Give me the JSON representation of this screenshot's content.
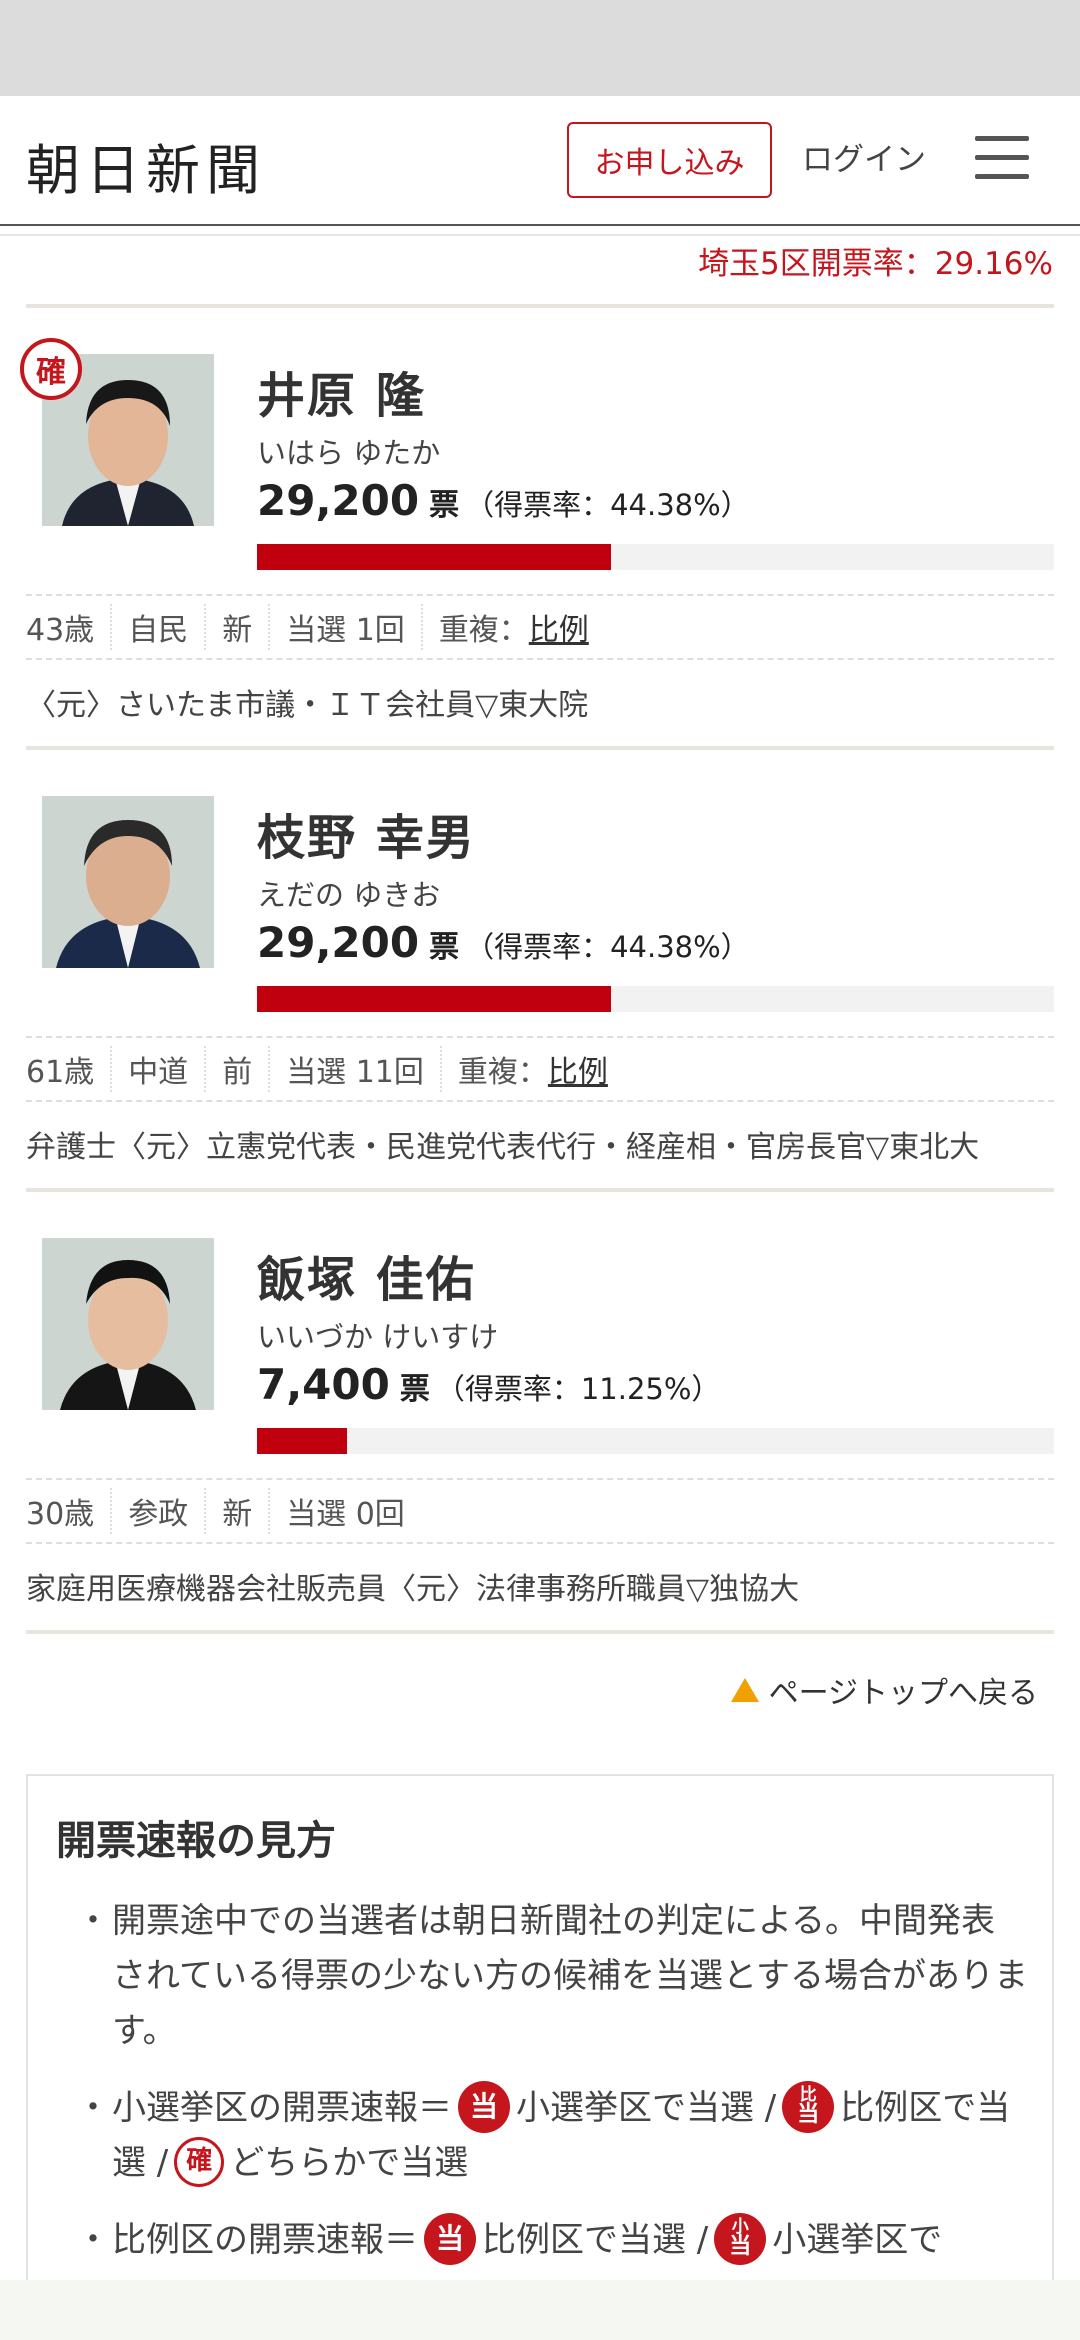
{
  "header": {
    "logo": "朝日新聞",
    "subscribe_label": "お申し込み",
    "login_label": "ログイン",
    "menu_icon": "hamburger-menu-icon"
  },
  "district_rate": "埼玉5区開票率：29.16%",
  "candidates": [
    {
      "elected_badge": "確",
      "name": "井原 隆",
      "kana": "いはら ゆたか",
      "votes": "29,200",
      "vote_unit": "票",
      "vote_share_text": "（得票率：44.38%）",
      "vote_share": 44.38,
      "meta": [
        "43歳",
        "自民",
        "新",
        "当選 1回"
      ],
      "duplicate_label": "重複：",
      "duplicate_link": "比例",
      "career": "〈元〉さいたま市議・ＩＴ会社員▽東大院"
    },
    {
      "elected_badge": "",
      "name": "枝野 幸男",
      "kana": "えだの ゆきお",
      "votes": "29,200",
      "vote_unit": "票",
      "vote_share_text": "（得票率：44.38%）",
      "vote_share": 44.38,
      "meta": [
        "61歳",
        "中道",
        "前",
        "当選 11回"
      ],
      "duplicate_label": "重複：",
      "duplicate_link": "比例",
      "career": "弁護士〈元〉立憲党代表・民進党代表代行・経産相・官房長官▽東北大"
    },
    {
      "elected_badge": "",
      "name": "飯塚 佳佑",
      "kana": "いいづか けいすけ",
      "votes": "7,400",
      "vote_unit": "票",
      "vote_share_text": "（得票率：11.25%）",
      "vote_share": 11.25,
      "meta": [
        "30歳",
        "参政",
        "新",
        "当選 0回"
      ],
      "duplicate_label": "",
      "duplicate_link": "",
      "career": "家庭用医療機器会社販売員〈元〉法律事務所職員▽独協大"
    }
  ],
  "page_top_label": "ページトップへ戻る",
  "guide": {
    "title": "開票速報の見方",
    "bullet": "・",
    "item1": "開票途中での当選者は朝日新聞社の判定による。中間発表されている得票の少ない方の候補を当選とする場合があります。",
    "item2_a": "小選挙区の開票速報＝",
    "item2_b": "小選挙区で当選 /",
    "item2_c": "比例区で当選 /",
    "item2_d": "どちらかで当選",
    "item3_a": "比例区の開票速報＝",
    "item3_b": "比例区で当選 /",
    "item3_c": "小選挙区で",
    "mark_tou": "当",
    "mark_hi_top": "比",
    "mark_hi_bottom": "当",
    "mark_ko_top": "小",
    "mark_ko_bottom": "当",
    "mark_kaku": "確"
  },
  "colors": {
    "accent_red": "#c4161c",
    "bar_red": "#c0000e",
    "pagetop_triangle": "#f0a000"
  }
}
